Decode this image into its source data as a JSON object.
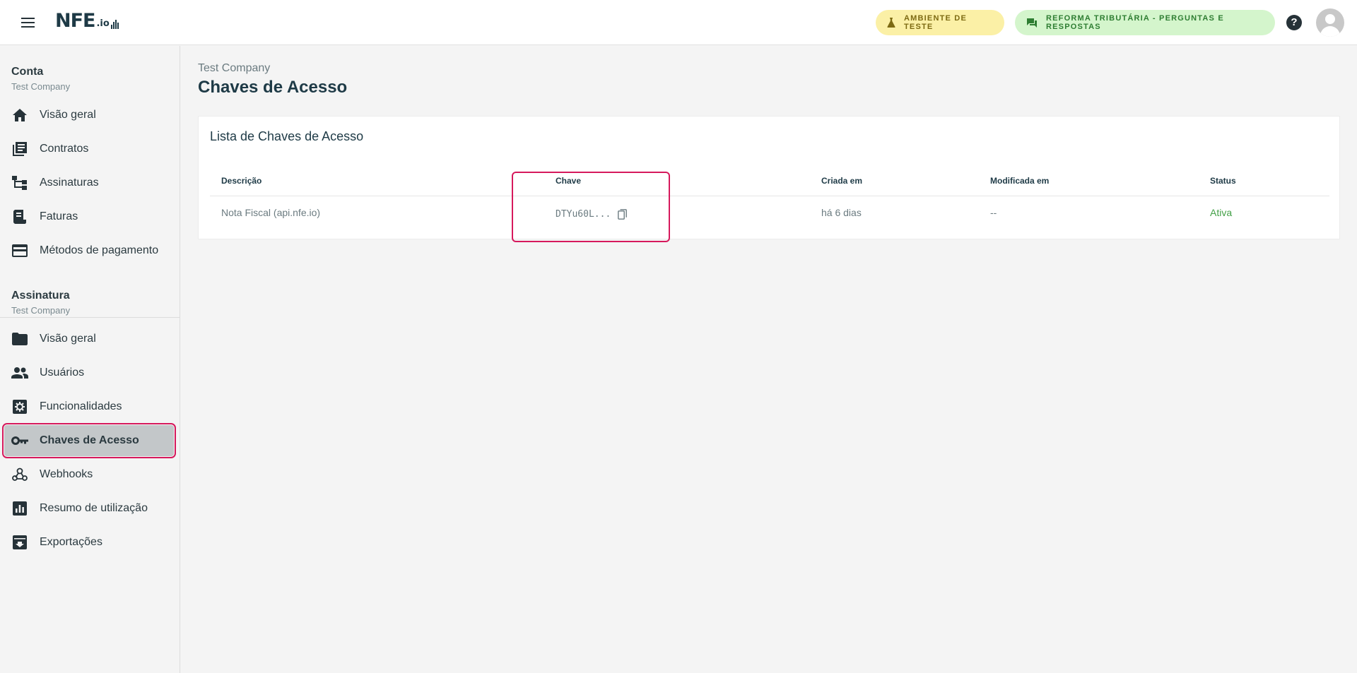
{
  "header": {
    "logo_text": "NFE",
    "logo_suffix": ".io",
    "test_env_label": "AMBIENTE DE TESTE",
    "reform_label": "REFORMA TRIBUTÁRIA - PERGUNTAS E RESPOSTAS",
    "help_symbol": "?"
  },
  "sidebar": {
    "account": {
      "title": "Conta",
      "subtitle": "Test Company"
    },
    "account_items": [
      {
        "label": "Visão geral",
        "icon": "home-icon"
      },
      {
        "label": "Contratos",
        "icon": "contracts-icon"
      },
      {
        "label": "Assinaturas",
        "icon": "subscriptions-icon"
      },
      {
        "label": "Faturas",
        "icon": "invoices-icon"
      },
      {
        "label": "Métodos de pagamento",
        "icon": "credit-card-icon"
      }
    ],
    "subscription": {
      "title": "Assinatura",
      "subtitle": "Test Company"
    },
    "subscription_items": [
      {
        "label": "Visão geral",
        "icon": "folder-icon"
      },
      {
        "label": "Usuários",
        "icon": "users-icon"
      },
      {
        "label": "Funcionalidades",
        "icon": "features-icon"
      },
      {
        "label": "Chaves de Acesso",
        "icon": "key-icon",
        "active": true
      },
      {
        "label": "Webhooks",
        "icon": "webhooks-icon"
      },
      {
        "label": "Resumo de utilização",
        "icon": "chart-icon"
      },
      {
        "label": "Exportações",
        "icon": "archive-icon"
      }
    ]
  },
  "main": {
    "breadcrumb": "Test Company",
    "title": "Chaves de Acesso",
    "card_title": "Lista de Chaves de Acesso",
    "columns": [
      "Descrição",
      "Chave",
      "Criada em",
      "Modificada em",
      "Status"
    ],
    "rows": [
      {
        "descricao": "Nota Fiscal (api.nfe.io)",
        "chave": "DTYu60L...",
        "criada": "há 6 dias",
        "modificada": "--",
        "status": "Ativa"
      }
    ]
  },
  "colors": {
    "accent_highlight": "#d6195c",
    "status_active": "#43a047",
    "test_pill_bg": "#fbf0a6",
    "reform_pill_bg": "#d4f5cc"
  }
}
